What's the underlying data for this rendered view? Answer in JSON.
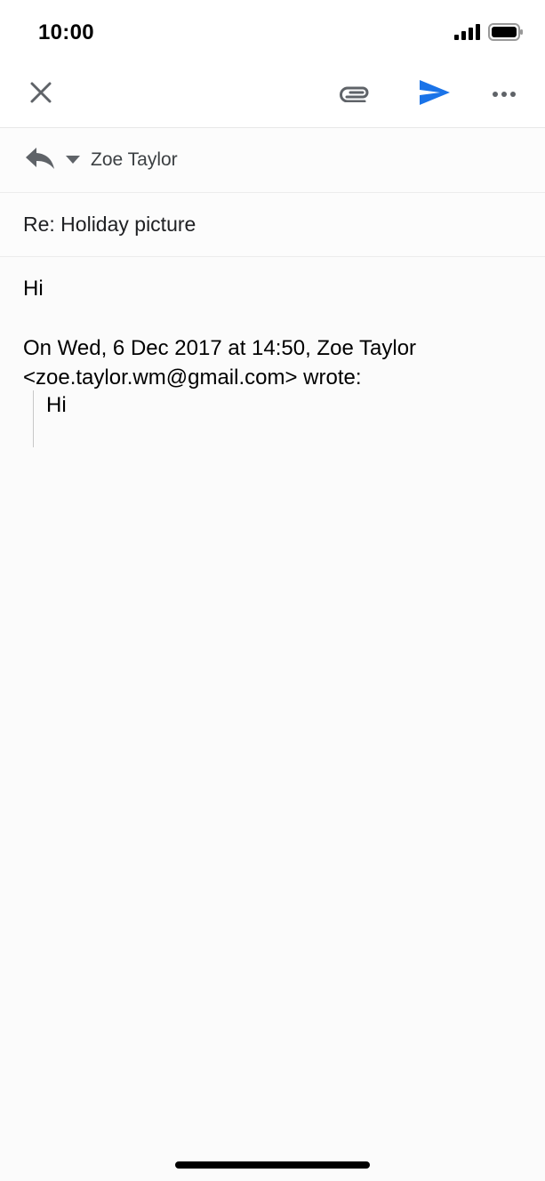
{
  "status_bar": {
    "time": "10:00",
    "signal_icon": "cellular-signal-icon",
    "battery_icon": "battery-icon"
  },
  "toolbar": {
    "close_icon": "close-icon",
    "attach_icon": "paperclip-icon",
    "send_icon": "send-icon",
    "more_icon": "more-horizontal-icon"
  },
  "colors": {
    "accent": "#1a73e8",
    "icon_gray": "#5f6368",
    "divider": "#ececec"
  },
  "compose": {
    "reply_icon": "reply-icon",
    "dropdown_icon": "chevron-down-icon",
    "recipient": "Zoe Taylor",
    "subject": "Re: Holiday picture",
    "body": "Hi",
    "quote_header": "On Wed, 6 Dec 2017 at 14:50, Zoe Taylor <zoe.taylor.wm@gmail.com> wrote:",
    "quoted_body": "Hi"
  }
}
